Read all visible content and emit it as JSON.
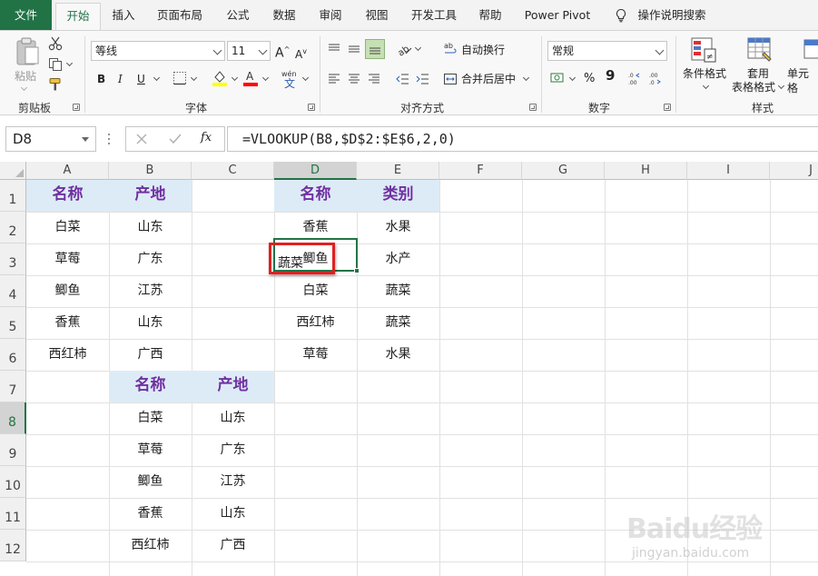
{
  "menu": {
    "tabs": [
      "文件",
      "开始",
      "插入",
      "页面布局",
      "公式",
      "数据",
      "审阅",
      "视图",
      "开发工具",
      "帮助",
      "Power Pivot"
    ],
    "active": "开始",
    "search": "操作说明搜索"
  },
  "ribbon": {
    "clipboard": {
      "paste": "粘贴",
      "label": "剪贴板"
    },
    "font": {
      "name": "等线",
      "size": "11",
      "bold": "B",
      "italic": "I",
      "underline": "U",
      "wen": "wén",
      "wen_char": "文",
      "label": "字体",
      "fill_color": "#ffff00",
      "font_color": "#ff0000"
    },
    "alignment": {
      "wrap": "自动换行",
      "merge": "合并后居中",
      "label": "对齐方式"
    },
    "number": {
      "format": "常规",
      "percent": "%",
      "comma": "9",
      "label": "数字"
    },
    "styles": {
      "conditional": "条件格式",
      "table1": "套用",
      "table2": "表格格式",
      "cell": "单元格",
      "label": "样式"
    }
  },
  "formula_bar": {
    "name_box": "D8",
    "fx": "fx",
    "formula": "=VLOOKUP(B8,$D$2:$E$6,2,0)"
  },
  "sheet": {
    "columns": [
      "A",
      "B",
      "C",
      "D",
      "E",
      "F",
      "G",
      "H",
      "I",
      "J"
    ],
    "selected_column": "D",
    "rows": [
      "1",
      "2",
      "3",
      "4",
      "5",
      "6",
      "7",
      "8",
      "9",
      "10",
      "11",
      "12"
    ],
    "selected_row": "8",
    "table1": {
      "headers": [
        "名称",
        "产地"
      ],
      "rows": [
        [
          "白菜",
          "山东"
        ],
        [
          "草莓",
          "广东"
        ],
        [
          "鲫鱼",
          "江苏"
        ],
        [
          "香蕉",
          "山东"
        ],
        [
          "西红柿",
          "广西"
        ]
      ]
    },
    "table2": {
      "headers": [
        "名称",
        "类别"
      ],
      "rows": [
        [
          "香蕉",
          "水果"
        ],
        [
          "鲫鱼",
          "水产"
        ],
        [
          "白菜",
          "蔬菜"
        ],
        [
          "西红柿",
          "蔬菜"
        ],
        [
          "草莓",
          "水果"
        ]
      ]
    },
    "table3": {
      "headers": [
        "名称",
        "产地"
      ],
      "rows": [
        [
          "白菜",
          "山东"
        ],
        [
          "草莓",
          "广东"
        ],
        [
          "鲫鱼",
          "江苏"
        ],
        [
          "香蕉",
          "山东"
        ],
        [
          "西红柿",
          "广西"
        ]
      ]
    },
    "active_value": "蔬菜",
    "accent": "#217346",
    "header_fill": "#ddebf7",
    "header_text": "#7030a0"
  },
  "watermark": {
    "main": "Baidu经验",
    "sub": "jingyan.baidu.com"
  }
}
